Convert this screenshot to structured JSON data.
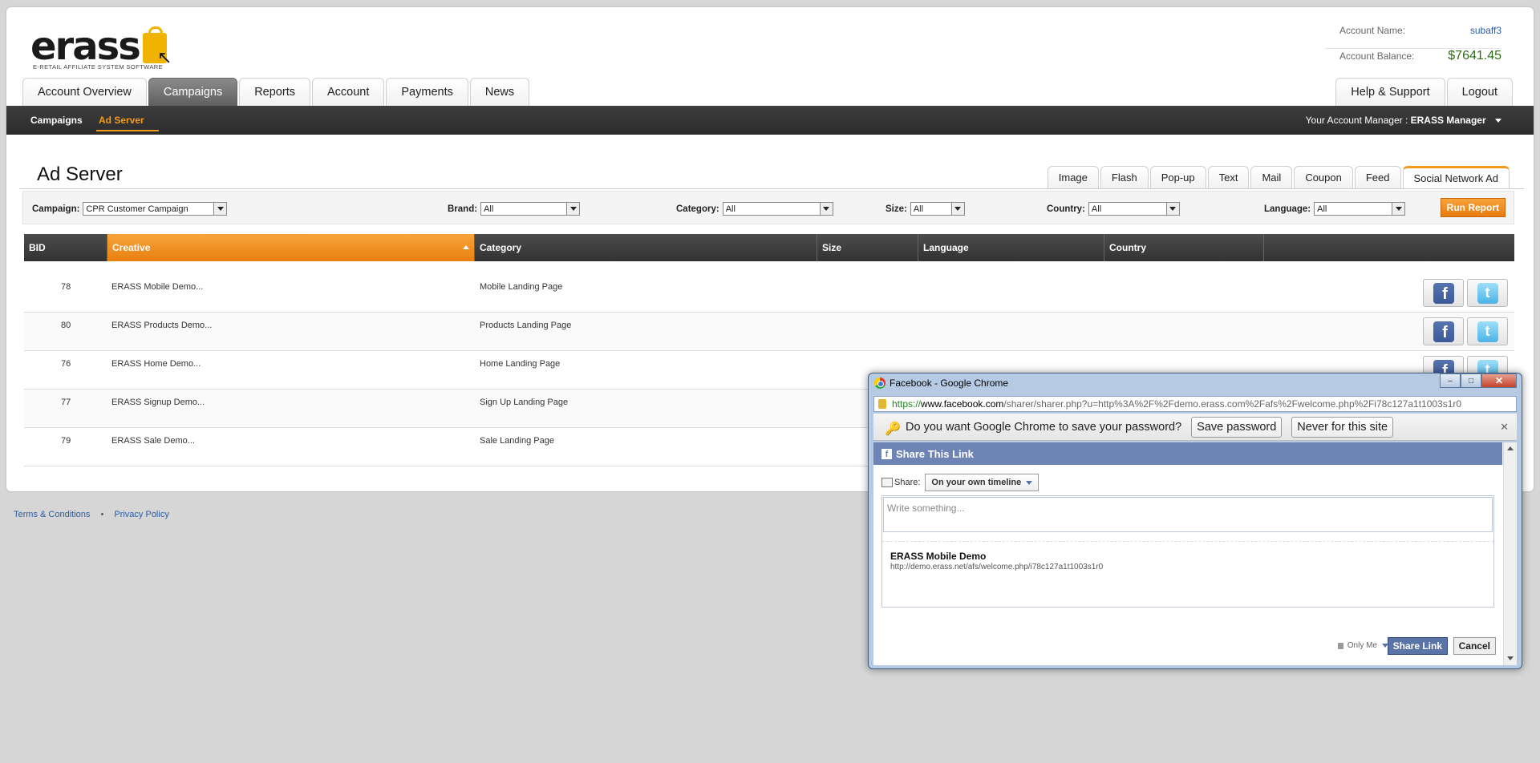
{
  "logo": {
    "text": "erass",
    "tagline": "E-RETAIL AFFILIATE SYSTEM SOFTWARE"
  },
  "account": {
    "name_label": "Account Name:",
    "name": "subaff3",
    "balance_label": "Account Balance:",
    "balance": "$7641.45"
  },
  "main_tabs": [
    {
      "label": "Account Overview"
    },
    {
      "label": "Campaigns"
    },
    {
      "label": "Reports"
    },
    {
      "label": "Account"
    },
    {
      "label": "Payments"
    },
    {
      "label": "News"
    }
  ],
  "right_tabs": [
    {
      "label": "Help & Support"
    },
    {
      "label": "Logout"
    }
  ],
  "subnav": {
    "items": [
      {
        "label": "Campaigns"
      },
      {
        "label": "Ad Server"
      }
    ],
    "manager_label": "Your Account Manager :",
    "manager_name": "ERASS Manager"
  },
  "page_title": "Ad Server",
  "ad_tabs": [
    {
      "label": "Image"
    },
    {
      "label": "Flash"
    },
    {
      "label": "Pop-up"
    },
    {
      "label": "Text"
    },
    {
      "label": "Mail"
    },
    {
      "label": "Coupon"
    },
    {
      "label": "Feed"
    },
    {
      "label": "Social Network Ad"
    }
  ],
  "filters": {
    "campaign": {
      "label": "Campaign:",
      "value": "CPR Customer Campaign"
    },
    "brand": {
      "label": "Brand:",
      "value": "All"
    },
    "category": {
      "label": "Category:",
      "value": "All"
    },
    "size": {
      "label": "Size:",
      "value": "All"
    },
    "country": {
      "label": "Country:",
      "value": "All"
    },
    "language": {
      "label": "Language:",
      "value": "All"
    },
    "run_label": "Run Report"
  },
  "table": {
    "headers": [
      "BID",
      "Creative",
      "Category",
      "Size",
      "Language",
      "Country"
    ],
    "rows": [
      {
        "bid": "78",
        "creative": "ERASS Mobile Demo...",
        "category": "Mobile Landing Page"
      },
      {
        "bid": "80",
        "creative": "ERASS Products Demo...",
        "category": "Products Landing Page"
      },
      {
        "bid": "76",
        "creative": "ERASS Home Demo...",
        "category": "Home Landing Page"
      },
      {
        "bid": "77",
        "creative": "ERASS Signup Demo...",
        "category": "Sign Up Landing Page"
      },
      {
        "bid": "79",
        "creative": "ERASS Sale Demo...",
        "category": "Sale Landing Page"
      }
    ]
  },
  "footer": {
    "terms": "Terms & Conditions",
    "dot": "•",
    "privacy": "Privacy Policy"
  },
  "popup": {
    "title": "Facebook - Google Chrome",
    "url_scheme": "https://",
    "url_domain": "www.facebook.com",
    "url_rest": "/sharer/sharer.php?u=http%3A%2F%2Fdemo.erass.com%2Fafs%2Fwelcome.php%2Fi78c127a1t1003s1r0",
    "infobar_text": "Do you want Google Chrome to save your password?",
    "save_password": "Save password",
    "never_site": "Never for this site",
    "fb_header": "Share This Link",
    "share_label": "Share:",
    "share_target": "On your own timeline",
    "write_placeholder": "Write something...",
    "attach_title": "ERASS Mobile Demo",
    "attach_url": "http://demo.erass.net/afs/welcome.php/i78c127a1t1003s1r0",
    "privacy": "Only Me",
    "share_button": "Share Link",
    "cancel_button": "Cancel"
  }
}
